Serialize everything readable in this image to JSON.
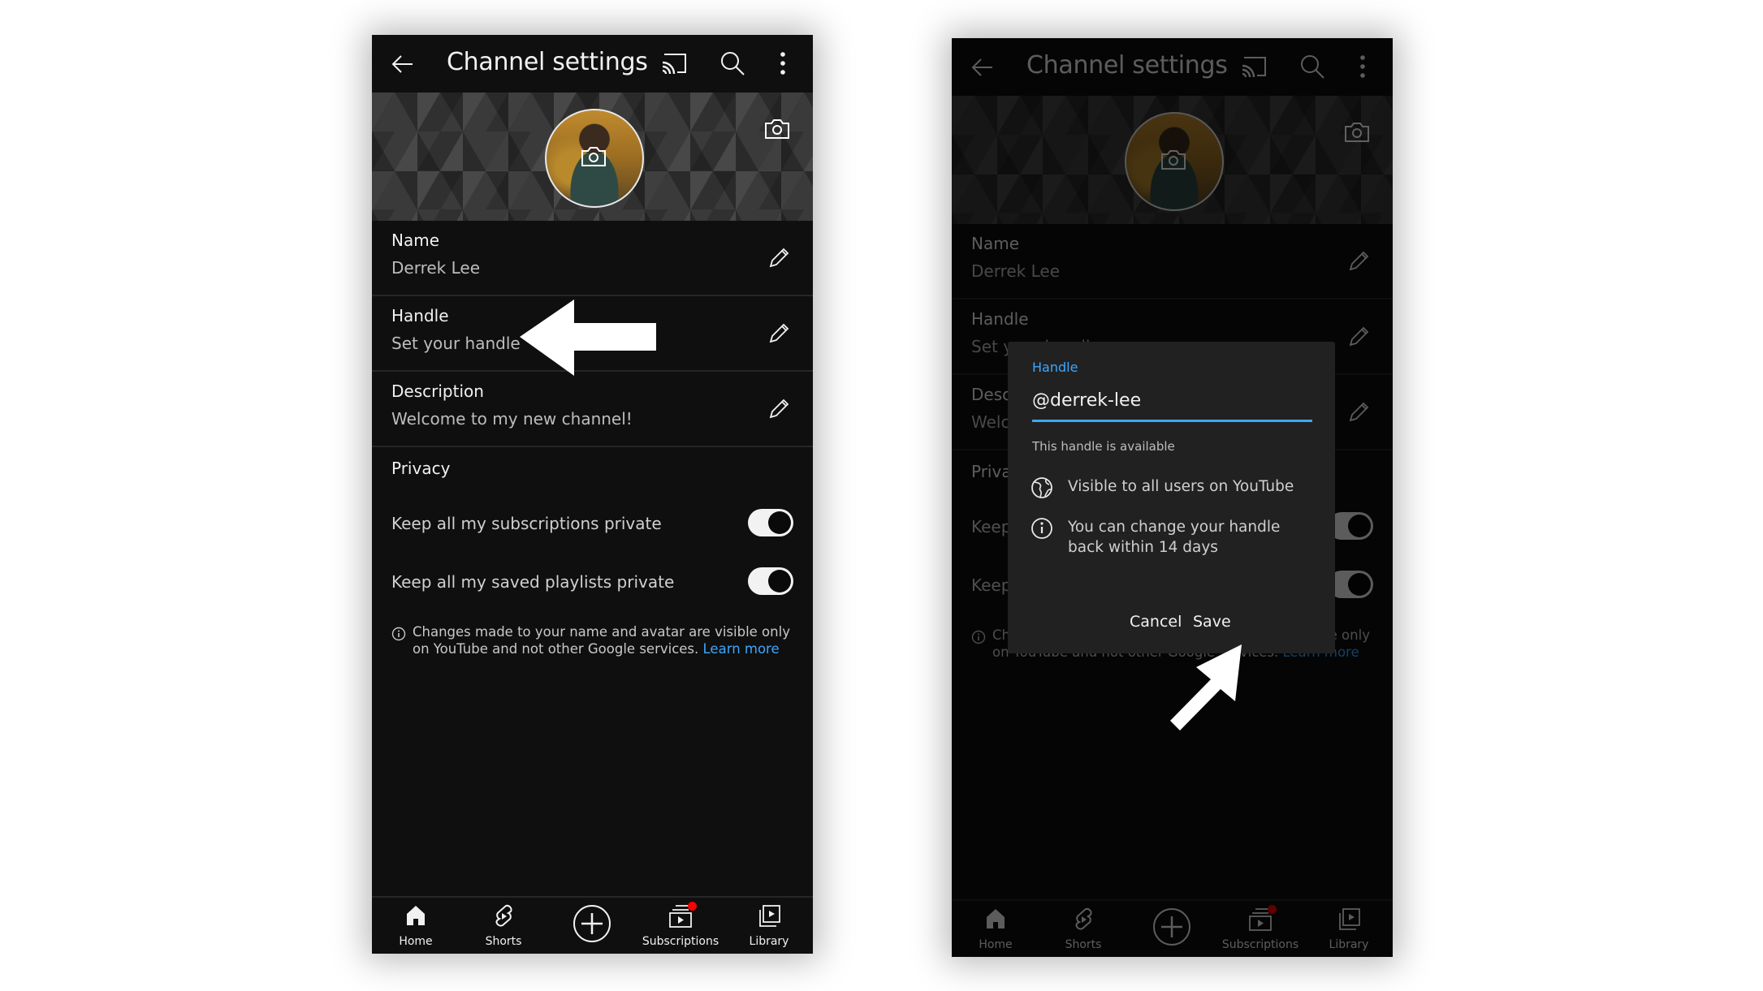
{
  "screens": [
    {
      "id": "left",
      "appbar": {
        "title": "Channel settings",
        "icons": [
          "back-arrow-icon",
          "cast-icon",
          "search-icon",
          "more-vert-icon"
        ]
      },
      "banner": {
        "icons": [
          "camera-icon"
        ]
      },
      "rows": [
        {
          "label": "Name",
          "value": "Derrek Lee"
        },
        {
          "label": "Handle",
          "value": "Set your handle"
        },
        {
          "label": "Description",
          "value": "Welcome to my new channel!"
        }
      ],
      "privacy": {
        "title": "Privacy",
        "toggles": [
          {
            "label": "Keep all my subscriptions private",
            "on": true
          },
          {
            "label": "Keep all my saved playlists private",
            "on": true
          }
        ]
      },
      "footer_note": {
        "text": "Changes made to your name and avatar are visible only on YouTube and not other Google services.",
        "link": "Learn more"
      },
      "bottom_nav": [
        {
          "label": "Home",
          "icon": "home-icon"
        },
        {
          "label": "Shorts",
          "icon": "shorts-icon"
        },
        {
          "label": "",
          "icon": "create-plus-icon"
        },
        {
          "label": "Subscriptions",
          "icon": "subscriptions-icon",
          "badge": true
        },
        {
          "label": "Library",
          "icon": "library-icon"
        }
      ]
    },
    {
      "id": "right",
      "appbar": {
        "title": "Channel settings"
      },
      "rows": [
        {
          "label": "Name",
          "value": "Derrek Lee"
        },
        {
          "label": "Handle",
          "value": "Set your handle"
        },
        {
          "label": "Description",
          "value": "Welcome to my new channel!"
        }
      ],
      "privacy": {
        "title": "Privacy",
        "toggles": [
          {
            "label": "Keep all my subscriptions private",
            "on": true
          },
          {
            "label": "Keep all my saved playlists private",
            "on": true
          }
        ]
      },
      "footer_note": {
        "text": "Changes made to your name and avatar are visible only on YouTube and not other Google services.",
        "link": "Learn more"
      },
      "bottom_nav": [
        {
          "label": "Home"
        },
        {
          "label": "Shorts"
        },
        {
          "label": ""
        },
        {
          "label": "Subscriptions",
          "badge": true
        },
        {
          "label": "Library"
        }
      ],
      "dialog": {
        "field_label": "Handle",
        "prefix": "@",
        "value": "derrek-lee",
        "status": "This handle is available",
        "info_lines": [
          {
            "icon": "globe-icon",
            "text": "Visible to all users on YouTube"
          },
          {
            "icon": "info-icon",
            "text": "You can change your handle back within 14 days"
          }
        ],
        "cancel_label": "Cancel",
        "save_label": "Save"
      }
    }
  ],
  "annotations": [
    {
      "type": "arrow",
      "points_to": "handle-row"
    },
    {
      "type": "arrow",
      "points_to": "save-button"
    }
  ],
  "colors": {
    "accent": "#3ea6ff",
    "badge": "#ff0000",
    "surface": "#0f0f0f",
    "dialog": "#212121"
  }
}
